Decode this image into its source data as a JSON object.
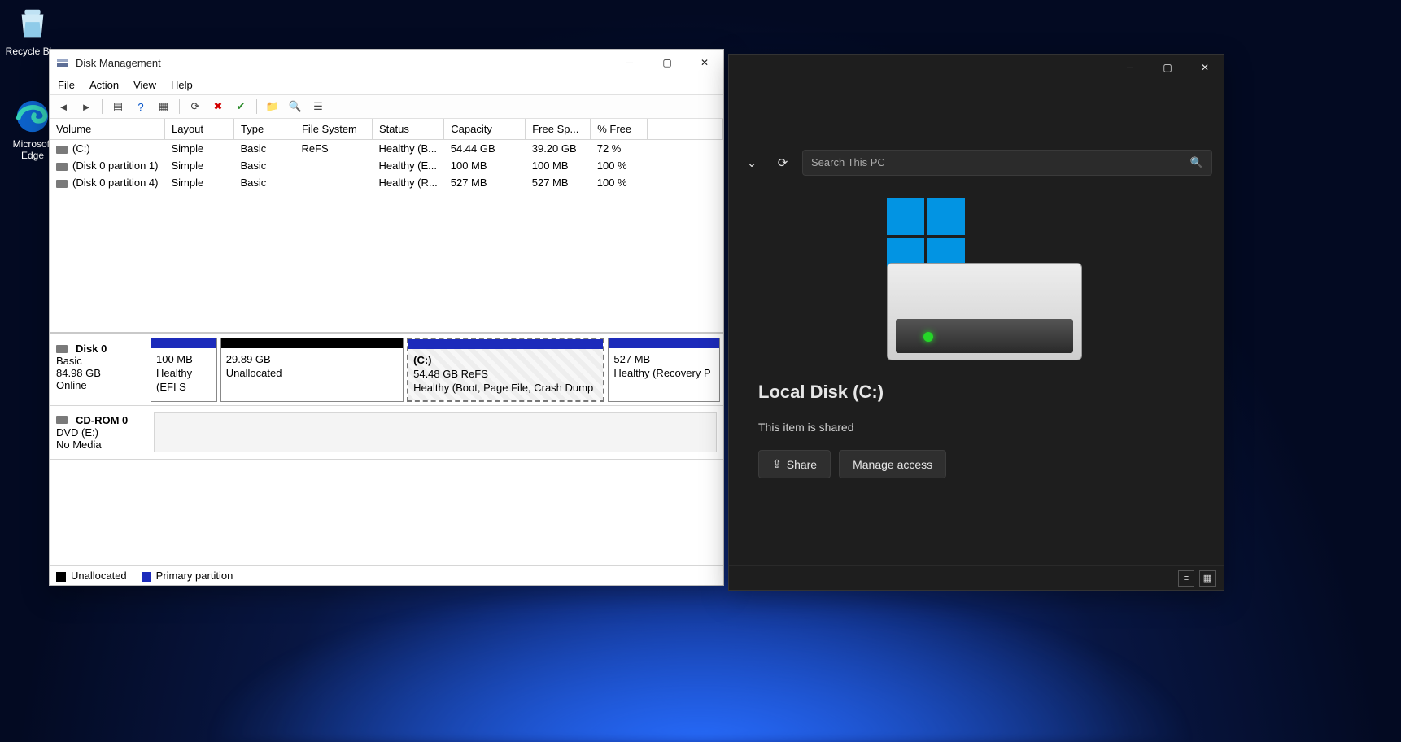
{
  "desktop": {
    "recycle_label": "Recycle Bi...",
    "edge_label": "Microsoft Edge"
  },
  "dm": {
    "title": "Disk Management",
    "menu": [
      "File",
      "Action",
      "View",
      "Help"
    ],
    "columns": [
      "Volume",
      "Layout",
      "Type",
      "File System",
      "Status",
      "Capacity",
      "Free Sp...",
      "% Free"
    ],
    "rows": [
      {
        "vol": "(C:)",
        "layout": "Simple",
        "type": "Basic",
        "fs": "ReFS",
        "status": "Healthy (B...",
        "cap": "54.44 GB",
        "free": "39.20 GB",
        "pct": "72 %"
      },
      {
        "vol": "(Disk 0 partition 1)",
        "layout": "Simple",
        "type": "Basic",
        "fs": "",
        "status": "Healthy (E...",
        "cap": "100 MB",
        "free": "100 MB",
        "pct": "100 %"
      },
      {
        "vol": "(Disk 0 partition 4)",
        "layout": "Simple",
        "type": "Basic",
        "fs": "",
        "status": "Healthy (R...",
        "cap": "527 MB",
        "free": "527 MB",
        "pct": "100 %"
      }
    ],
    "disks": [
      {
        "name": "Disk 0",
        "type": "Basic",
        "size": "84.98 GB",
        "state": "Online",
        "parts": [
          {
            "kind": "primary",
            "l1": "",
            "l2": "100 MB",
            "l3": "Healthy (EFI S",
            "flex": 10
          },
          {
            "kind": "unalloc",
            "l1": "",
            "l2": "29.89 GB",
            "l3": "Unallocated",
            "flex": 28
          },
          {
            "kind": "primary",
            "l1": "(C:)",
            "l2": "54.48 GB ReFS",
            "l3": "Healthy (Boot, Page File, Crash Dump",
            "flex": 30,
            "selected": true,
            "hatched": true
          },
          {
            "kind": "primary",
            "l1": "",
            "l2": "527 MB",
            "l3": "Healthy (Recovery P",
            "flex": 17
          }
        ]
      },
      {
        "name": "CD-ROM 0",
        "type": "DVD (E:)",
        "size": "",
        "state": "No Media",
        "parts": []
      }
    ],
    "legend": {
      "unallocated": "Unallocated",
      "primary": "Primary partition"
    }
  },
  "explorer": {
    "search_placeholder": "Search This PC",
    "drive_title": "Local Disk (C:)",
    "shared_text": "This item is shared",
    "share_label": "Share",
    "manage_label": "Manage access"
  }
}
